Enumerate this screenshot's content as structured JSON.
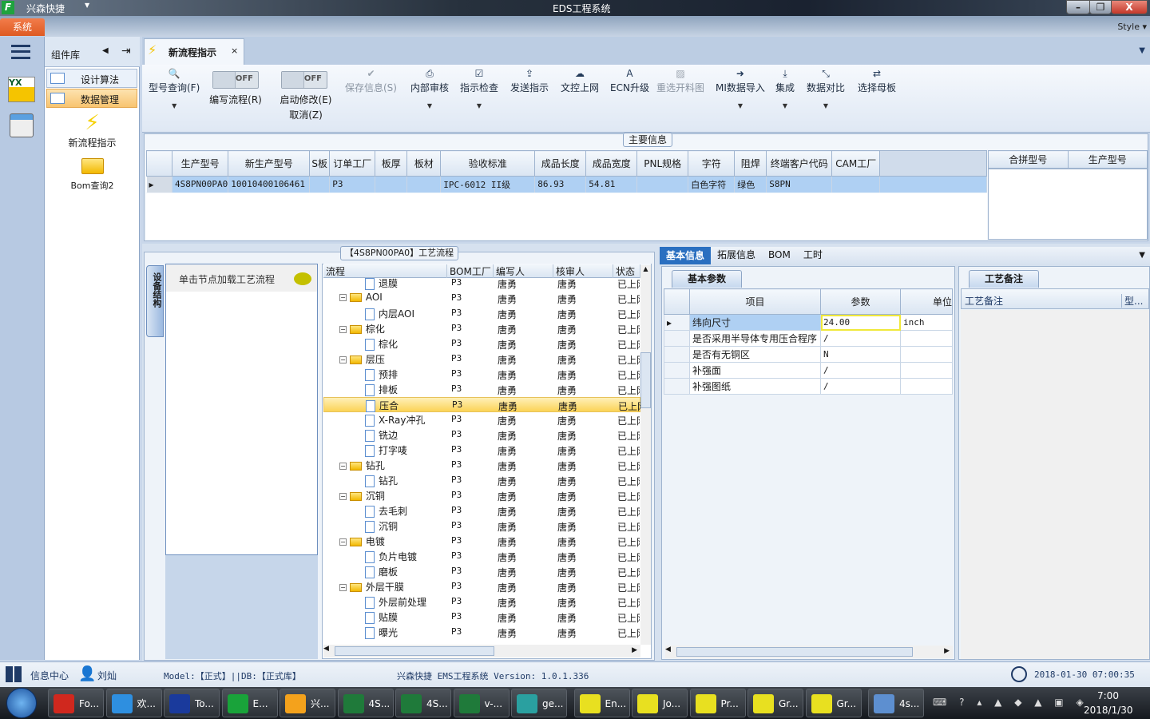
{
  "window": {
    "app_name": "兴森快捷",
    "title": "EDS工程系统",
    "style_label": "Style",
    "system_menu": "系统"
  },
  "component_panel": {
    "title": "组件库",
    "items": [
      {
        "label": "设计算法"
      },
      {
        "label": "数据管理",
        "selected": true
      }
    ],
    "launchers": [
      {
        "label": "新流程指示",
        "icon": "lightning-icon"
      },
      {
        "label": "Bom查询2",
        "icon": "folder-open-icon"
      }
    ]
  },
  "doc_tab": {
    "label": "新流程指示"
  },
  "ribbon": {
    "buttons": [
      {
        "label": "型号查询(F)",
        "icon": "search-icon",
        "dropdown": true
      },
      {
        "label": "保存信息(S)",
        "icon": "check-icon",
        "disabled": true
      },
      {
        "label": "内部审核",
        "icon": "printer-icon",
        "dropdown": true
      },
      {
        "label": "指示检查",
        "icon": "checkbox-icon",
        "dropdown": true
      },
      {
        "label": "发送指示",
        "icon": "upload-icon"
      },
      {
        "label": "文控上网",
        "icon": "cloud-upload-icon"
      },
      {
        "label": "ECN升级",
        "icon": "font-a-icon"
      },
      {
        "label": "重选开料图",
        "icon": "image-icon",
        "disabled": true
      },
      {
        "label": "MI数据导入",
        "icon": "sign-in-icon",
        "dropdown": true
      },
      {
        "label": "集成",
        "icon": "download-icon",
        "dropdown": true
      },
      {
        "label": "数据对比",
        "icon": "compress-icon",
        "dropdown": true
      },
      {
        "label": "选择母板",
        "icon": "shuffle-icon"
      }
    ],
    "toggles": [
      {
        "label": "编写流程(R)",
        "state": "OFF"
      },
      {
        "label": "启动修改(E)",
        "sub_label": "取消(Z)",
        "state": "OFF"
      }
    ]
  },
  "main_info": {
    "group_label": "主要信息",
    "columns": [
      "生产型号",
      "新生产型号",
      "S板",
      "订单工厂",
      "板厚",
      "板材",
      "验收标准",
      "成品长度",
      "成品宽度",
      "PNL规格",
      "字符",
      "阻焊",
      "终端客户代码",
      "CAM工厂"
    ],
    "rows": [
      [
        "4S8PN00PA0",
        "10010400106461",
        "",
        "P3",
        "",
        "",
        "IPC-6012 II级",
        "86.93",
        "54.81",
        "",
        "白色字符",
        "绿色",
        "S8PN",
        ""
      ]
    ],
    "side_columns": [
      "合拼型号",
      "生产型号"
    ]
  },
  "process": {
    "title": "【4S8PN00PA0】工艺流程",
    "side_tab": "设备结构",
    "hint": "单击节点加载工艺流程",
    "columns": [
      "流程",
      "BOM工厂",
      "编写人",
      "核审人",
      "状态"
    ],
    "rows": [
      {
        "name": "退膜",
        "type": "doc",
        "factory": "P3",
        "writer": "唐勇",
        "reviewer": "唐勇",
        "status": "已上网"
      },
      {
        "name": "AOI",
        "type": "folder",
        "factory": "P3",
        "writer": "唐勇",
        "reviewer": "唐勇",
        "status": "已上网"
      },
      {
        "name": "内层AOI",
        "type": "doc",
        "factory": "P3",
        "writer": "唐勇",
        "reviewer": "唐勇",
        "status": "已上网"
      },
      {
        "name": "棕化",
        "type": "folder",
        "factory": "P3",
        "writer": "唐勇",
        "reviewer": "唐勇",
        "status": "已上网"
      },
      {
        "name": "棕化",
        "type": "doc",
        "factory": "P3",
        "writer": "唐勇",
        "reviewer": "唐勇",
        "status": "已上网"
      },
      {
        "name": "层压",
        "type": "folder",
        "factory": "P3",
        "writer": "唐勇",
        "reviewer": "唐勇",
        "status": "已上网"
      },
      {
        "name": "预排",
        "type": "doc",
        "factory": "P3",
        "writer": "唐勇",
        "reviewer": "唐勇",
        "status": "已上网"
      },
      {
        "name": "排板",
        "type": "doc",
        "factory": "P3",
        "writer": "唐勇",
        "reviewer": "唐勇",
        "status": "已上网"
      },
      {
        "name": "压合",
        "type": "doc",
        "factory": "P3",
        "writer": "唐勇",
        "reviewer": "唐勇",
        "status": "已上网",
        "selected": true
      },
      {
        "name": "X-Ray冲孔",
        "type": "doc",
        "factory": "P3",
        "writer": "唐勇",
        "reviewer": "唐勇",
        "status": "已上网"
      },
      {
        "name": "铣边",
        "type": "doc",
        "factory": "P3",
        "writer": "唐勇",
        "reviewer": "唐勇",
        "status": "已上网"
      },
      {
        "name": "打字唛",
        "type": "doc",
        "factory": "P3",
        "writer": "唐勇",
        "reviewer": "唐勇",
        "status": "已上网"
      },
      {
        "name": "钻孔",
        "type": "folder",
        "factory": "P3",
        "writer": "唐勇",
        "reviewer": "唐勇",
        "status": "已上网"
      },
      {
        "name": "钻孔",
        "type": "doc",
        "factory": "P3",
        "writer": "唐勇",
        "reviewer": "唐勇",
        "status": "已上网"
      },
      {
        "name": "沉铜",
        "type": "folder",
        "factory": "P3",
        "writer": "唐勇",
        "reviewer": "唐勇",
        "status": "已上网"
      },
      {
        "name": "去毛刺",
        "type": "doc",
        "factory": "P3",
        "writer": "唐勇",
        "reviewer": "唐勇",
        "status": "已上网"
      },
      {
        "name": "沉铜",
        "type": "doc",
        "factory": "P3",
        "writer": "唐勇",
        "reviewer": "唐勇",
        "status": "已上网"
      },
      {
        "name": "电镀",
        "type": "folder",
        "factory": "P3",
        "writer": "唐勇",
        "reviewer": "唐勇",
        "status": "已上网"
      },
      {
        "name": "负片电镀",
        "type": "doc",
        "factory": "P3",
        "writer": "唐勇",
        "reviewer": "唐勇",
        "status": "已上网"
      },
      {
        "name": "磨板",
        "type": "doc",
        "factory": "P3",
        "writer": "唐勇",
        "reviewer": "唐勇",
        "status": "已上网"
      },
      {
        "name": "外层干膜",
        "type": "folder",
        "factory": "P3",
        "writer": "唐勇",
        "reviewer": "唐勇",
        "status": "已上网"
      },
      {
        "name": "外层前处理",
        "type": "doc",
        "factory": "P3",
        "writer": "唐勇",
        "reviewer": "唐勇",
        "status": "已上网"
      },
      {
        "name": "贴膜",
        "type": "doc",
        "factory": "P3",
        "writer": "唐勇",
        "reviewer": "唐勇",
        "status": "已上网"
      },
      {
        "name": "曝光",
        "type": "doc",
        "factory": "P3",
        "writer": "唐勇",
        "reviewer": "唐勇",
        "status": "已上网"
      }
    ]
  },
  "detail": {
    "tabs": [
      "基本信息",
      "拓展信息",
      "BOM",
      "工时"
    ],
    "active_tab": "基本信息",
    "params_tab": "基本参数",
    "param_columns": [
      "项目",
      "参数",
      "单位"
    ],
    "params": [
      [
        "纬向尺寸",
        "24.00",
        "inch"
      ],
      [
        "是否采用半导体专用压合程序",
        "/",
        ""
      ],
      [
        "是否有无铜区",
        "N",
        ""
      ],
      [
        "补强面",
        "/",
        ""
      ],
      [
        "补强图纸",
        "/",
        ""
      ]
    ],
    "notes_tab": "工艺备注",
    "notes_columns": [
      "工艺备注",
      "型..."
    ]
  },
  "status_bar": {
    "info_center": "信息中心",
    "user": "刘灿",
    "model": "Model:【正式】||DB:【正式库】",
    "product": "兴森快捷 EMS工程系统  Version: 1.0.1.336",
    "datetime": "2018-01-30 07:00:35"
  },
  "taskbar": {
    "items": [
      {
        "label": "Fo...",
        "color": "#d0281e"
      },
      {
        "label": "欢...",
        "color": "#2e8fe0"
      },
      {
        "label": "To...",
        "color": "#1a3a9c"
      },
      {
        "label": "E...",
        "color": "#19a33a"
      },
      {
        "label": "兴...",
        "color": "#f4a21c"
      },
      {
        "label": "4S...",
        "color": "#1f7a3a"
      },
      {
        "label": "4S...",
        "color": "#1f7a3a"
      },
      {
        "label": "v-...",
        "color": "#1f7a3a"
      },
      {
        "label": "ge...",
        "color": "#2aa0a0"
      },
      {
        "label": "En...",
        "color": "#e8e020"
      },
      {
        "label": "Jo...",
        "color": "#e8e020"
      },
      {
        "label": "Pr...",
        "color": "#e8e020"
      },
      {
        "label": "Gr...",
        "color": "#e8e020"
      },
      {
        "label": "Gr...",
        "color": "#e8e020"
      },
      {
        "label": "4s...",
        "color": "#5d8fd0"
      }
    ],
    "clock_time": "7:00",
    "clock_date": "2018/1/30"
  }
}
